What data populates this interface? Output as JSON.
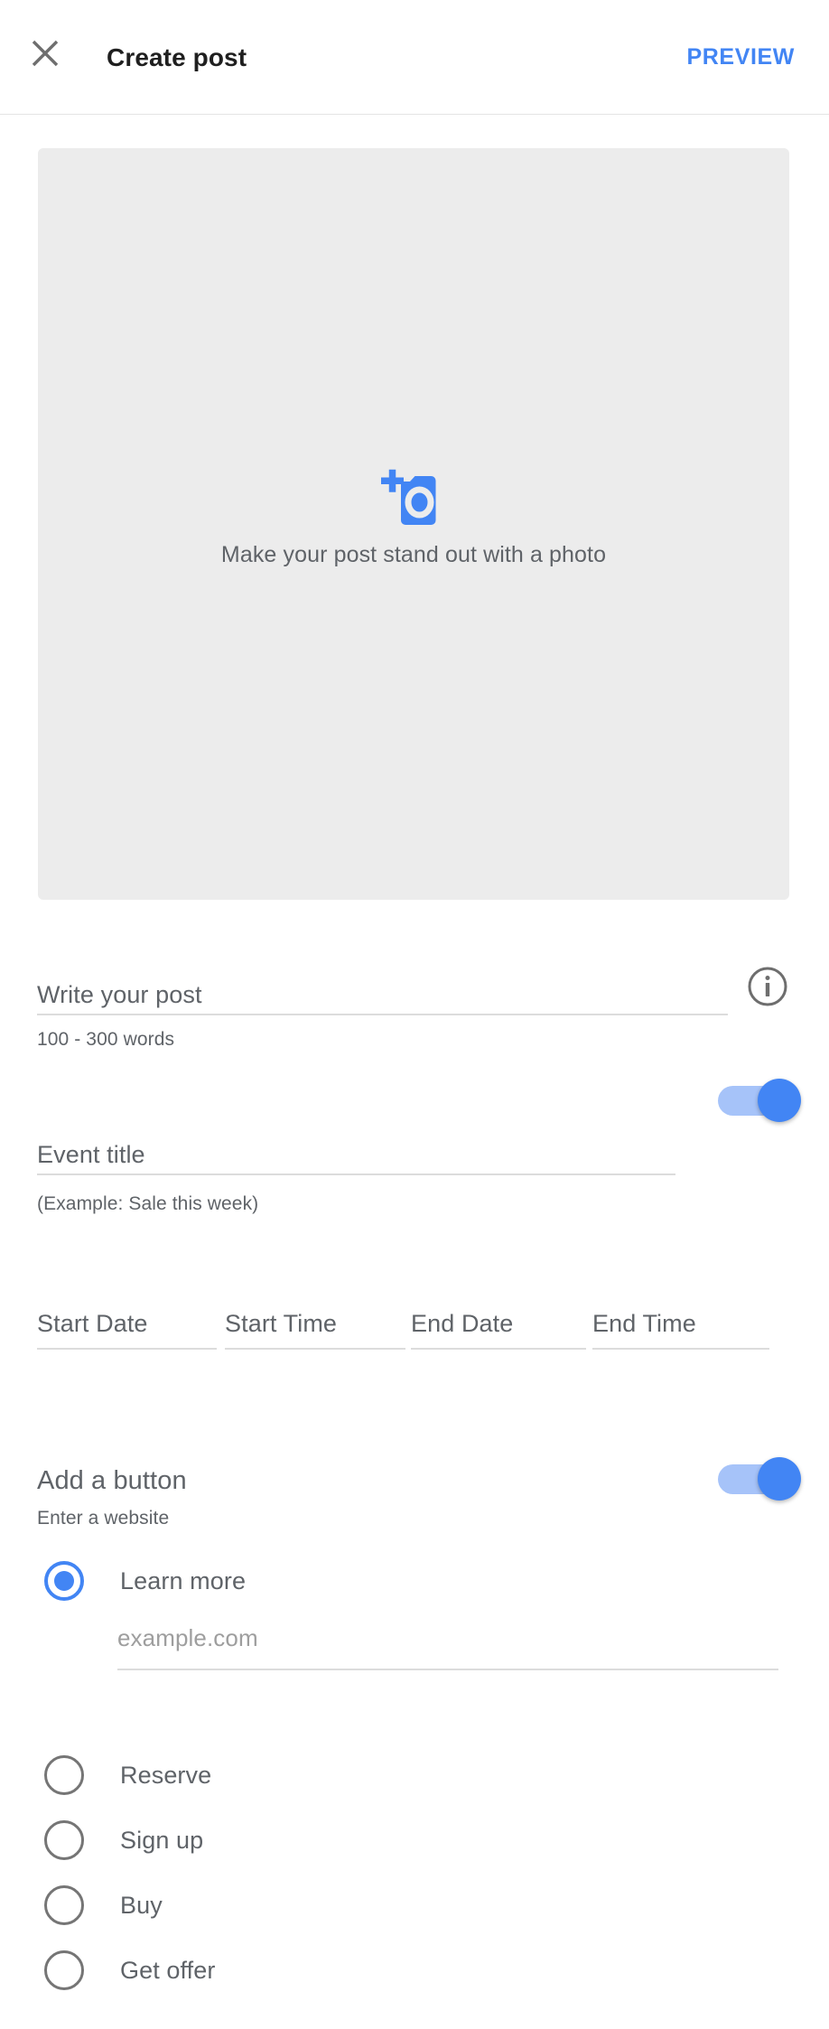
{
  "header": {
    "close_icon": "close-icon",
    "title": "Create post",
    "preview_label": "PREVIEW"
  },
  "photo": {
    "icon": "add-a-photo-icon",
    "hint": "Make your post stand out with a photo"
  },
  "post_text": {
    "placeholder": "Write your post",
    "helper": "100 - 300 words",
    "info_icon": "info-icon"
  },
  "event": {
    "toggle_on": true,
    "title_placeholder": "Event title",
    "title_helper": "(Example: Sale this week)",
    "datetime_fields": [
      {
        "label": "Start Date"
      },
      {
        "label": "Start Time"
      },
      {
        "label": "End Date"
      },
      {
        "label": "End Time"
      }
    ]
  },
  "add_button": {
    "title": "Add a button",
    "helper": "Enter a website",
    "toggle_on": true,
    "url_placeholder": "example.com",
    "options": [
      {
        "label": "Learn more",
        "selected": true
      },
      {
        "label": "Reserve",
        "selected": false
      },
      {
        "label": "Sign up",
        "selected": false
      },
      {
        "label": "Buy",
        "selected": false
      },
      {
        "label": "Get offer",
        "selected": false
      }
    ]
  },
  "colors": {
    "accent": "#4285f4",
    "toggle_track": "#a6c3f9",
    "text_primary": "#1f1f1f",
    "text_secondary": "#5f6368",
    "photo_zone_bg": "#ececec",
    "underline": "#dcdcdc"
  }
}
